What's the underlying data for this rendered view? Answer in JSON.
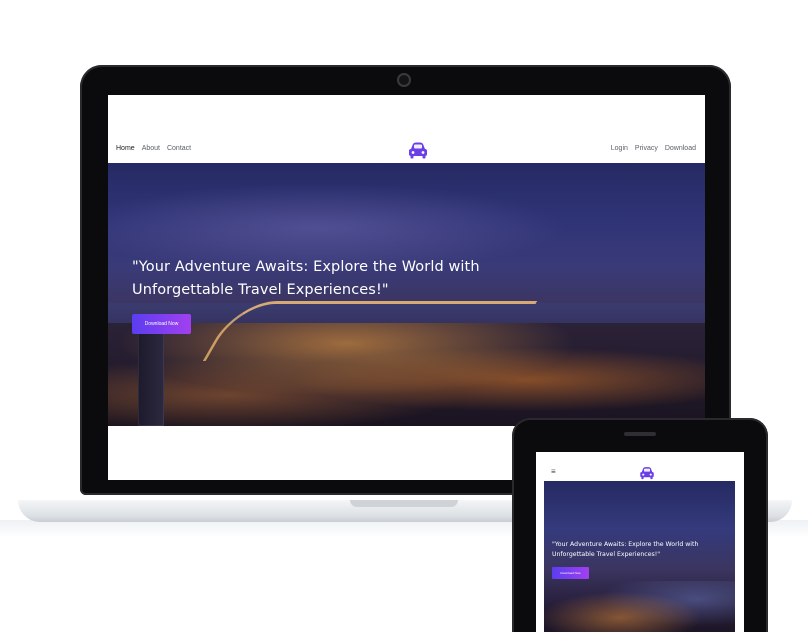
{
  "colors": {
    "accent_start": "#5b3df0",
    "accent_end": "#a140f0",
    "device_frame": "#0b0b0d"
  },
  "desktop": {
    "nav_left": [
      {
        "label": "Home",
        "active": true
      },
      {
        "label": "About",
        "active": false
      },
      {
        "label": "Contact",
        "active": false
      }
    ],
    "logo_icon": "car-icon",
    "nav_right": [
      {
        "label": "Login"
      },
      {
        "label": "Privacy"
      },
      {
        "label": "Download"
      }
    ],
    "hero": {
      "title": "\"Your Adventure Awaits: Explore the World with Unforgettable Travel Experiences!\"",
      "button_label": "Download Now"
    }
  },
  "mobile": {
    "menu_icon": "hamburger-icon",
    "menu_glyph": "≡",
    "logo_icon": "car-icon",
    "hero": {
      "title": "\"Your Adventure Awaits: Explore the World with Unforgettable Travel Experiences!\"",
      "button_label": "Download Now"
    }
  }
}
